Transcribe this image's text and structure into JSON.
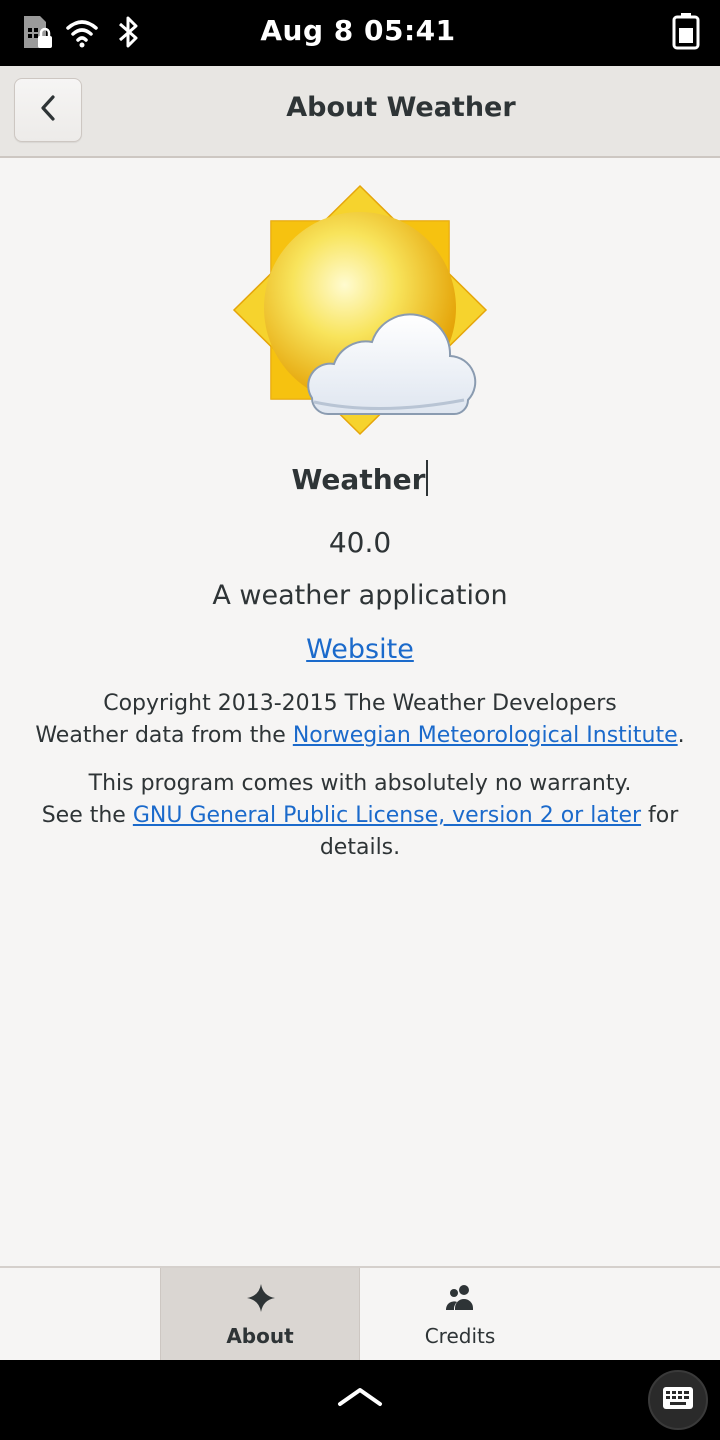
{
  "status_bar": {
    "clock": "Aug 8  05:41",
    "icons": [
      "sim-locked-icon",
      "wifi-icon",
      "bluetooth-icon",
      "battery-icon"
    ]
  },
  "header": {
    "title": "About Weather",
    "back_icon": "chevron-left-icon"
  },
  "about": {
    "app_name": "Weather",
    "version": "40.0",
    "comments": "A weather application",
    "website_label": "Website",
    "copyright_line": "Copyright 2013-2015 The Weather Developers",
    "data_prefix": "Weather data from the ",
    "data_link": "Norwegian Meteorological Institute",
    "data_suffix": ".",
    "warranty_line": "This program comes with absolutely no warranty.",
    "license_prefix": "See the ",
    "license_link": "GNU General Public License, version 2 or later",
    "license_suffix": " for details."
  },
  "tabs": [
    {
      "label": "About",
      "icon": "sparkle-icon",
      "active": true
    },
    {
      "label": "Credits",
      "icon": "people-icon",
      "active": false
    }
  ],
  "nav": {
    "handle_icon": "chevron-up-icon",
    "keyboard_icon": "keyboard-icon"
  },
  "colors": {
    "link": "#1b6acb",
    "background": "#f6f5f4",
    "header": "#e8e6e3",
    "sun": "#f5c211"
  }
}
